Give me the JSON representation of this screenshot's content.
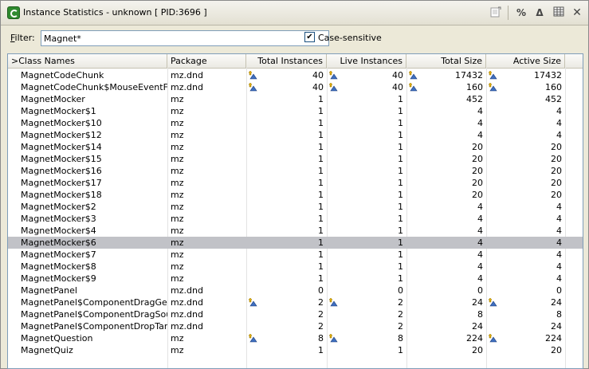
{
  "window": {
    "title": "Instance Statistics - unknown [ PID:3696 ]",
    "toolbar": {
      "percent": "%",
      "delta": "Δ"
    }
  },
  "filter": {
    "label_pre": "",
    "label_hot": "F",
    "label_post": "ilter:",
    "value": "Magnet*",
    "case_checked": true,
    "case_label": "Case-sensitive"
  },
  "table": {
    "columns": [
      "Class Names",
      "Package",
      "Total Instances",
      "Live Instances",
      "Total Size",
      "Active Size"
    ],
    "sort_marker": ">",
    "rows": [
      {
        "name": "MagnetCodeChunk",
        "pkg": "mz.dnd",
        "ti": "40",
        "li": "40",
        "ts": "17432",
        "as": "17432",
        "icons": [
          true,
          true,
          true,
          true
        ]
      },
      {
        "name": "MagnetCodeChunk$MouseEventFo...",
        "pkg": "mz.dnd",
        "ti": "40",
        "li": "40",
        "ts": "160",
        "as": "160",
        "icons": [
          true,
          true,
          true,
          true
        ]
      },
      {
        "name": "MagnetMocker",
        "pkg": "mz",
        "ti": "1",
        "li": "1",
        "ts": "452",
        "as": "452",
        "icons": [
          false,
          false,
          false,
          false
        ]
      },
      {
        "name": "MagnetMocker$1",
        "pkg": "mz",
        "ti": "1",
        "li": "1",
        "ts": "4",
        "as": "4",
        "icons": [
          false,
          false,
          false,
          false
        ]
      },
      {
        "name": "MagnetMocker$10",
        "pkg": "mz",
        "ti": "1",
        "li": "1",
        "ts": "4",
        "as": "4",
        "icons": [
          false,
          false,
          false,
          false
        ]
      },
      {
        "name": "MagnetMocker$12",
        "pkg": "mz",
        "ti": "1",
        "li": "1",
        "ts": "4",
        "as": "4",
        "icons": [
          false,
          false,
          false,
          false
        ]
      },
      {
        "name": "MagnetMocker$14",
        "pkg": "mz",
        "ti": "1",
        "li": "1",
        "ts": "20",
        "as": "20",
        "icons": [
          false,
          false,
          false,
          false
        ]
      },
      {
        "name": "MagnetMocker$15",
        "pkg": "mz",
        "ti": "1",
        "li": "1",
        "ts": "20",
        "as": "20",
        "icons": [
          false,
          false,
          false,
          false
        ]
      },
      {
        "name": "MagnetMocker$16",
        "pkg": "mz",
        "ti": "1",
        "li": "1",
        "ts": "20",
        "as": "20",
        "icons": [
          false,
          false,
          false,
          false
        ]
      },
      {
        "name": "MagnetMocker$17",
        "pkg": "mz",
        "ti": "1",
        "li": "1",
        "ts": "20",
        "as": "20",
        "icons": [
          false,
          false,
          false,
          false
        ]
      },
      {
        "name": "MagnetMocker$18",
        "pkg": "mz",
        "ti": "1",
        "li": "1",
        "ts": "20",
        "as": "20",
        "icons": [
          false,
          false,
          false,
          false
        ]
      },
      {
        "name": "MagnetMocker$2",
        "pkg": "mz",
        "ti": "1",
        "li": "1",
        "ts": "4",
        "as": "4",
        "icons": [
          false,
          false,
          false,
          false
        ]
      },
      {
        "name": "MagnetMocker$3",
        "pkg": "mz",
        "ti": "1",
        "li": "1",
        "ts": "4",
        "as": "4",
        "icons": [
          false,
          false,
          false,
          false
        ]
      },
      {
        "name": "MagnetMocker$4",
        "pkg": "mz",
        "ti": "1",
        "li": "1",
        "ts": "4",
        "as": "4",
        "icons": [
          false,
          false,
          false,
          false
        ]
      },
      {
        "name": "MagnetMocker$6",
        "pkg": "mz",
        "ti": "1",
        "li": "1",
        "ts": "4",
        "as": "4",
        "icons": [
          false,
          false,
          false,
          false
        ],
        "selected": true
      },
      {
        "name": "MagnetMocker$7",
        "pkg": "mz",
        "ti": "1",
        "li": "1",
        "ts": "4",
        "as": "4",
        "icons": [
          false,
          false,
          false,
          false
        ]
      },
      {
        "name": "MagnetMocker$8",
        "pkg": "mz",
        "ti": "1",
        "li": "1",
        "ts": "4",
        "as": "4",
        "icons": [
          false,
          false,
          false,
          false
        ]
      },
      {
        "name": "MagnetMocker$9",
        "pkg": "mz",
        "ti": "1",
        "li": "1",
        "ts": "4",
        "as": "4",
        "icons": [
          false,
          false,
          false,
          false
        ]
      },
      {
        "name": "MagnetPanel",
        "pkg": "mz.dnd",
        "ti": "0",
        "li": "0",
        "ts": "0",
        "as": "0",
        "icons": [
          false,
          false,
          false,
          false
        ]
      },
      {
        "name": "MagnetPanel$ComponentDragGest...",
        "pkg": "mz.dnd",
        "ti": "2",
        "li": "2",
        "ts": "24",
        "as": "24",
        "icons": [
          true,
          true,
          false,
          true
        ]
      },
      {
        "name": "MagnetPanel$ComponentDragSour...",
        "pkg": "mz.dnd",
        "ti": "2",
        "li": "2",
        "ts": "8",
        "as": "8",
        "icons": [
          false,
          false,
          false,
          false
        ]
      },
      {
        "name": "MagnetPanel$ComponentDropTarg...",
        "pkg": "mz.dnd",
        "ti": "2",
        "li": "2",
        "ts": "24",
        "as": "24",
        "icons": [
          false,
          false,
          false,
          false
        ]
      },
      {
        "name": "MagnetQuestion",
        "pkg": "mz",
        "ti": "8",
        "li": "8",
        "ts": "224",
        "as": "224",
        "icons": [
          true,
          true,
          false,
          true
        ]
      },
      {
        "name": "MagnetQuiz",
        "pkg": "mz",
        "ti": "1",
        "li": "1",
        "ts": "20",
        "as": "20",
        "icons": [
          false,
          false,
          false,
          false
        ]
      }
    ]
  },
  "icons": {
    "app": "profiler-app-icon",
    "export": "export-icon",
    "percent": "percent-icon",
    "delta": "delta-icon",
    "columns": "columns-icon",
    "close": "close-icon",
    "change": "change-arrow-icon"
  },
  "colors": {
    "selected_row": "#c1c2c7",
    "accent": "#2f8a2f"
  }
}
